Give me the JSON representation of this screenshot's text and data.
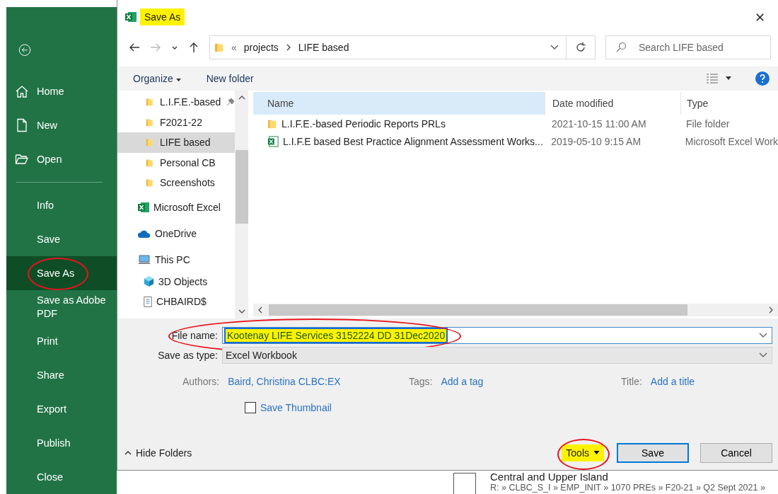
{
  "sidebar": {
    "items": [
      {
        "label": "Home",
        "kind": "home",
        "selected": false,
        "circled": false
      },
      {
        "label": "New",
        "kind": "new",
        "selected": false,
        "circled": false
      },
      {
        "label": "Open",
        "kind": "open",
        "selected": false,
        "circled": false
      },
      {
        "label": "Info",
        "kind": "text",
        "selected": false,
        "circled": false
      },
      {
        "label": "Save",
        "kind": "text",
        "selected": false,
        "circled": false
      },
      {
        "label": "Save As",
        "kind": "text",
        "selected": true,
        "circled": true
      },
      {
        "label": "Save as Adobe PDF",
        "kind": "text",
        "selected": false,
        "circled": false
      },
      {
        "label": "Print",
        "kind": "text",
        "selected": false,
        "circled": false
      },
      {
        "label": "Share",
        "kind": "text",
        "selected": false,
        "circled": false
      },
      {
        "label": "Export",
        "kind": "text",
        "selected": false,
        "circled": false
      },
      {
        "label": "Publish",
        "kind": "text",
        "selected": false,
        "circled": false
      },
      {
        "label": "Close",
        "kind": "text",
        "selected": false,
        "circled": false
      }
    ]
  },
  "dialog": {
    "title": "Save As",
    "title_highlighted": true,
    "close": "✕",
    "address": {
      "overflow": "«",
      "segments": [
        "projects",
        "LIFE based"
      ]
    },
    "search": {
      "placeholder": "Search LIFE based"
    },
    "toolbar": {
      "organize": "Organize",
      "new_folder": "New folder"
    },
    "nav_pane": [
      {
        "label": "L.I.F.E.-based",
        "kind": "folder",
        "pinned": true,
        "selected": false
      },
      {
        "label": "F2021-22",
        "kind": "folder",
        "pinned": false,
        "selected": false
      },
      {
        "label": "LIFE based",
        "kind": "folder",
        "pinned": false,
        "selected": true
      },
      {
        "label": "Personal CB",
        "kind": "folder",
        "pinned": false,
        "selected": false
      },
      {
        "label": "Screenshots",
        "kind": "folder",
        "pinned": false,
        "selected": false
      },
      {
        "label": "Microsoft Excel",
        "kind": "excel",
        "pinned": false,
        "selected": false
      },
      {
        "label": "OneDrive",
        "kind": "cloud",
        "pinned": false,
        "selected": false
      },
      {
        "label": "This PC",
        "kind": "pc",
        "pinned": false,
        "selected": false,
        "children": [
          {
            "label": "3D Objects",
            "kind": "cube",
            "pinned": false,
            "selected": false
          },
          {
            "label": "CHBAIRD$",
            "kind": "drive",
            "pinned": false,
            "selected": false
          }
        ]
      }
    ],
    "columns": [
      "Name",
      "Date modified",
      "Type"
    ],
    "files": [
      {
        "name": "L.I.F.E.-based Periodic Reports PRLs",
        "date": "2021-10-15 11:00 AM",
        "type": "File folder",
        "kind": "folder"
      },
      {
        "name": "L.I.F.E based Best Practice Alignment Assessment Works...",
        "date": "2019-05-10 9:15 AM",
        "type": "Microsoft Excel Work",
        "kind": "excel"
      }
    ],
    "file_name": {
      "label": "File name:",
      "value": "Kootenay LIFE Services 3152224 DD 31Dec2020",
      "highlighted": true,
      "circled": true
    },
    "save_as_type": {
      "label": "Save as type:",
      "value": "Excel Workbook"
    },
    "meta": [
      {
        "label": "Authors:",
        "value": "Baird, Christina CLBC:EX"
      },
      {
        "label": "Tags:",
        "value": "Add a tag"
      },
      {
        "label": "Title:",
        "value": "Add a title"
      }
    ],
    "save_thumbnail": {
      "label": "Save Thumbnail",
      "checked": false
    },
    "hide_folders": "Hide Folders",
    "tools": {
      "label": "Tools",
      "highlighted": true,
      "circled": true
    },
    "buttons": [
      "Save",
      "Cancel"
    ]
  },
  "background": {
    "checked": false,
    "title": "Central and Upper Island",
    "path": "R: » CLBC_S_I » EMP_INIT » 1070 PREs » F20-21 » Q2 Sept 2021 »"
  }
}
